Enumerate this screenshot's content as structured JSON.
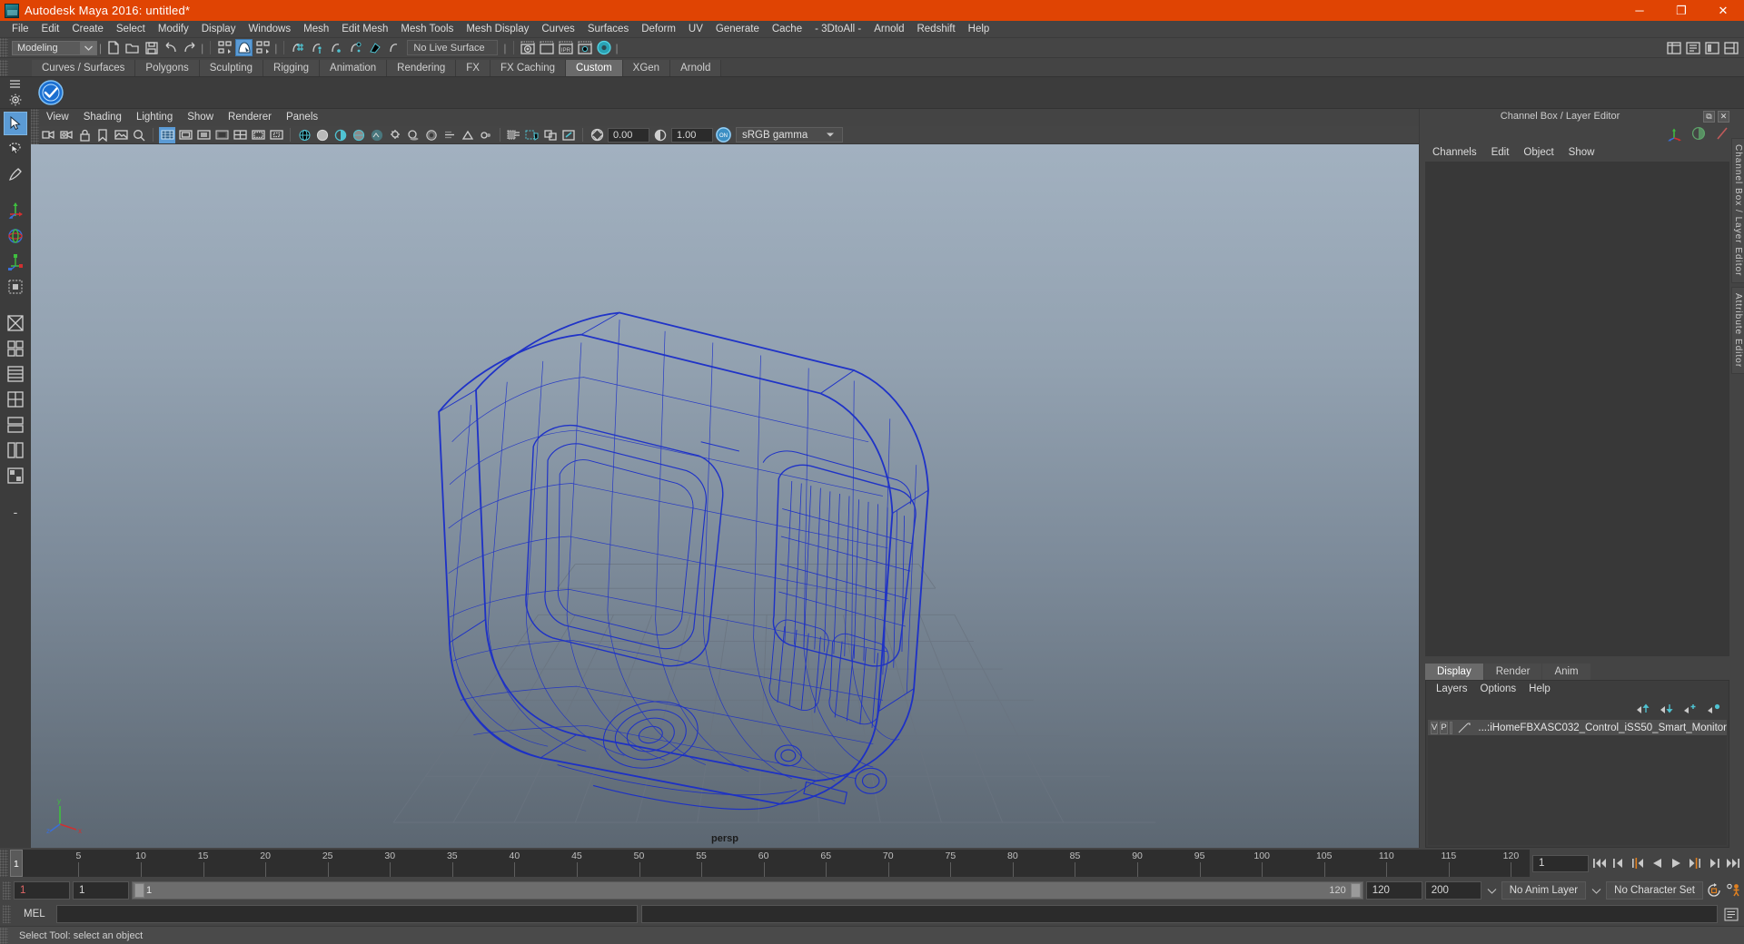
{
  "titlebar": {
    "title": "Autodesk Maya 2016: untitled*",
    "icon": "maya-logo-icon",
    "minimize": "─",
    "maximize": "❐",
    "close": "✕"
  },
  "menubar": {
    "items": [
      "File",
      "Edit",
      "Create",
      "Select",
      "Modify",
      "Display",
      "Windows",
      "Mesh",
      "Edit Mesh",
      "Mesh Tools",
      "Mesh Display",
      "Curves",
      "Surfaces",
      "Deform",
      "UV",
      "Generate",
      "Cache",
      "- 3DtoAll -",
      "Arnold",
      "Redshift",
      "Help"
    ]
  },
  "toolbar": {
    "menuset": "Modeling",
    "live_surface": "No Live Surface",
    "buttons": [
      "new-scene-icon",
      "open-scene-icon",
      "save-scene-icon",
      "undo-icon",
      "redo-icon",
      "select-by-hierarchy-icon",
      "select-by-object-icon",
      "select-by-component-icon",
      "snap-to-grid-icon",
      "snap-to-curve-icon",
      "snap-to-point-icon",
      "snap-to-projected-center-icon",
      "snap-to-view-plane-icon",
      "make-live-icon",
      "render-view-icon",
      "render-region-icon",
      "ipr-render-icon",
      "render-settings-icon",
      "hypershade-icon"
    ],
    "right_buttons": [
      "show-channel-box-icon",
      "show-attribute-editor-icon",
      "show-tool-settings-icon",
      "show-modeling-toolkit-icon"
    ]
  },
  "shelf": {
    "tabs": [
      "Curves / Surfaces",
      "Polygons",
      "Sculpting",
      "Rigging",
      "Animation",
      "Rendering",
      "FX",
      "FX Caching",
      "Custom",
      "XGen",
      "Arnold"
    ],
    "active_tab": "Custom",
    "item_icon": "blue-check-badge-icon"
  },
  "toolbox": {
    "items": [
      {
        "name": "select-tool",
        "selected": true
      },
      {
        "name": "lasso-select-tool",
        "selected": false
      },
      {
        "name": "paint-select-tool",
        "selected": false
      },
      {
        "name": "move-tool",
        "selected": false
      },
      {
        "name": "rotate-tool",
        "selected": false
      },
      {
        "name": "scale-tool",
        "selected": false
      },
      {
        "name": "last-tool-used",
        "selected": false
      },
      {
        "name": "single-perspective-layout",
        "selected": false
      },
      {
        "name": "four-view-layout",
        "selected": false
      },
      {
        "name": "persp-outliner-layout",
        "selected": false
      },
      {
        "name": "persp-graph-layout",
        "selected": false
      },
      {
        "name": "hypershade-persp-layout",
        "selected": false
      },
      {
        "name": "persp-render-layout",
        "selected": false
      },
      {
        "name": "more-layouts",
        "selected": false
      }
    ],
    "minus_label": "-"
  },
  "viewport": {
    "menus": [
      "View",
      "Shading",
      "Lighting",
      "Show",
      "Renderer",
      "Panels"
    ],
    "camera_label": "persp",
    "exposure": "0.00",
    "gamma": "1.00",
    "color_management": "sRGB gamma",
    "color_management_on": "ON",
    "toolbar_icons": [
      "select-camera-icon",
      "camera-attributes-icon",
      "lock-camera-icon",
      "bookmark-icon",
      "image-plane-icon",
      "two-d-pan-zoom-icon",
      "grid-toggle-icon",
      "film-gate-icon",
      "resolution-gate-icon",
      "gate-mask-icon",
      "field-chart-icon",
      "safe-action-icon",
      "safe-title-icon",
      "wireframe-icon",
      "smooth-shade-icon",
      "shade-all-icon",
      "wireframe-on-shaded-icon",
      "texture-icon",
      "use-all-lights-icon",
      "shadows-icon",
      "screen-space-ao-icon",
      "motion-blur-icon",
      "multisample-icon",
      "depth-of-field-icon",
      "isolate-select-icon",
      "xray-icon",
      "xray-joints-icon",
      "xray-active-components-icon",
      "exposure-icon",
      "gamma-icon",
      "color-management-icon"
    ],
    "axis_labels": {
      "x": "x",
      "y": "y",
      "z": "z"
    }
  },
  "right_panel": {
    "title": "Channel Box / Layer Editor",
    "float_button": "⧉",
    "close_button": "✕",
    "header_icons": [
      "axis-manip-icon",
      "half-circle-icon",
      "slash-icon"
    ],
    "menus": [
      "Channels",
      "Edit",
      "Object",
      "Show"
    ],
    "side_tabs": [
      "Channel Box / Layer Editor",
      "Attribute Editor"
    ],
    "layer_tabs": [
      "Display",
      "Render",
      "Anim"
    ],
    "active_layer_tab": "Display",
    "layer_menus": [
      "Layers",
      "Options",
      "Help"
    ],
    "layer_buttons": [
      "move-layer-up-icon",
      "move-layer-down-icon",
      "new-layer-icon",
      "new-layer-from-selected-icon"
    ],
    "layers": [
      {
        "visibility": "V",
        "playback": "P",
        "color": "",
        "name": "...:iHomeFBXASC032_Control_iSS50_Smart_Monitor"
      }
    ]
  },
  "timeline": {
    "ticks": [
      5,
      10,
      15,
      20,
      25,
      30,
      35,
      40,
      45,
      50,
      55,
      60,
      65,
      70,
      75,
      80,
      85,
      90,
      95,
      100,
      105,
      110,
      115,
      120
    ],
    "current_frame_marker": "1",
    "current_frame_field": "1",
    "playback_buttons": [
      "go-to-start-icon",
      "step-back-frame-icon",
      "step-back-key-icon",
      "play-backwards-icon",
      "play-forwards-icon",
      "step-forward-key-icon",
      "step-forward-frame-icon",
      "go-to-end-icon"
    ]
  },
  "range": {
    "anim_start": "1",
    "range_start": "1",
    "slider_start": "1",
    "slider_end": "120",
    "range_end": "120",
    "anim_end": "200",
    "anim_layer": "No Anim Layer",
    "character_set": "No Character Set",
    "auto_keyframe_icon": "auto-keyframe-icon",
    "anim_prefs_icon": "animation-preferences-icon"
  },
  "command_line": {
    "language_label": "MEL",
    "input_value": "",
    "input_placeholder": "",
    "script_editor_icon": "script-editor-icon"
  },
  "statusbar": {
    "message": "Select Tool: select an object"
  },
  "colors": {
    "title_bar": "#e04403",
    "panel_bg": "#444444",
    "accent_blue": "#5b9bd5",
    "accent_cyan": "#4fc3d2",
    "wireframe_blue": "#1b2fcf",
    "accent_orange": "#e08020"
  }
}
